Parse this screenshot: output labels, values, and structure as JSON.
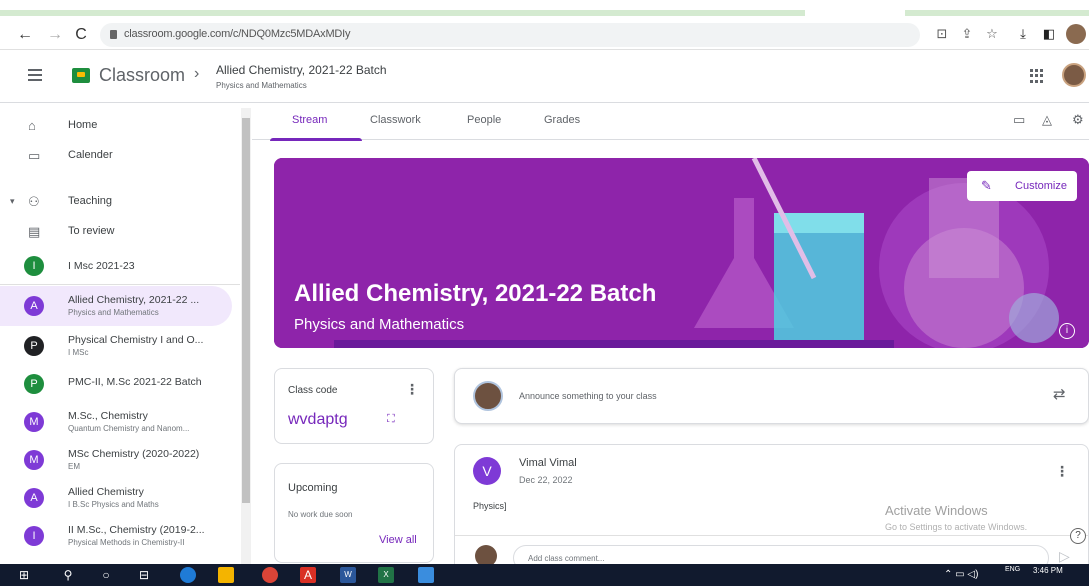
{
  "browser": {
    "url": "classroom.google.com/c/NDQ0Mzc5MDAxMDIy"
  },
  "header": {
    "app_title": "Classroom",
    "course_title": "Allied Chemistry, 2021-22 Batch",
    "course_subtitle": "Physics and Mathematics"
  },
  "sidebar": {
    "home": "Home",
    "calendar": "Calender",
    "teaching": "Teaching",
    "to_review": "To review",
    "classes": [
      {
        "initial": "I",
        "name": "I Msc 2021-23",
        "sub": "",
        "color": "#1e8e3e"
      },
      {
        "initial": "A",
        "name": "Allied Chemistry, 2021-22 ...",
        "sub": "Physics and Mathematics",
        "color": "#7e3ad6"
      },
      {
        "initial": "P",
        "name": "Physical Chemistry I and O...",
        "sub": "I MSc",
        "color": "#202124"
      },
      {
        "initial": "P",
        "name": "PMC-II, M.Sc 2021-22 Batch",
        "sub": "",
        "color": "#1e8e3e"
      },
      {
        "initial": "M",
        "name": "M.Sc., Chemistry",
        "sub": "Quantum Chemistry and Nanom...",
        "color": "#7e3ad6"
      },
      {
        "initial": "M",
        "name": "MSc Chemistry (2020-2022)",
        "sub": "EM",
        "color": "#7e3ad6"
      },
      {
        "initial": "A",
        "name": "Allied Chemistry",
        "sub": "I B.Sc Physics and Maths",
        "color": "#7e3ad6"
      },
      {
        "initial": "I",
        "name": "II M.Sc., Chemistry (2019-2...",
        "sub": "Physical Methods in Chemistry-II",
        "color": "#7e3ad6"
      }
    ]
  },
  "tabs": {
    "stream": "Stream",
    "classwork": "Classwork",
    "people": "People",
    "grades": "Grades"
  },
  "banner": {
    "title": "Allied Chemistry, 2021-22 Batch",
    "subtitle": "Physics and Mathematics",
    "customize": "Customize"
  },
  "class_code": {
    "label": "Class code",
    "value": "wvdaptg"
  },
  "upcoming": {
    "label": "Upcoming",
    "empty": "No work due soon",
    "view_all": "View all"
  },
  "announce": {
    "placeholder": "Announce something to your class"
  },
  "post": {
    "initial": "V",
    "author": "Vimal Vimal",
    "date": "Dec 22, 2022",
    "text": "Physics]",
    "comment_placeholder": "Add class comment..."
  },
  "watermark": {
    "line1": "Activate Windows",
    "line2": "Go to Settings to activate Windows."
  },
  "taskbar": {
    "lang": "ENG",
    "time": "3:46 PM"
  }
}
